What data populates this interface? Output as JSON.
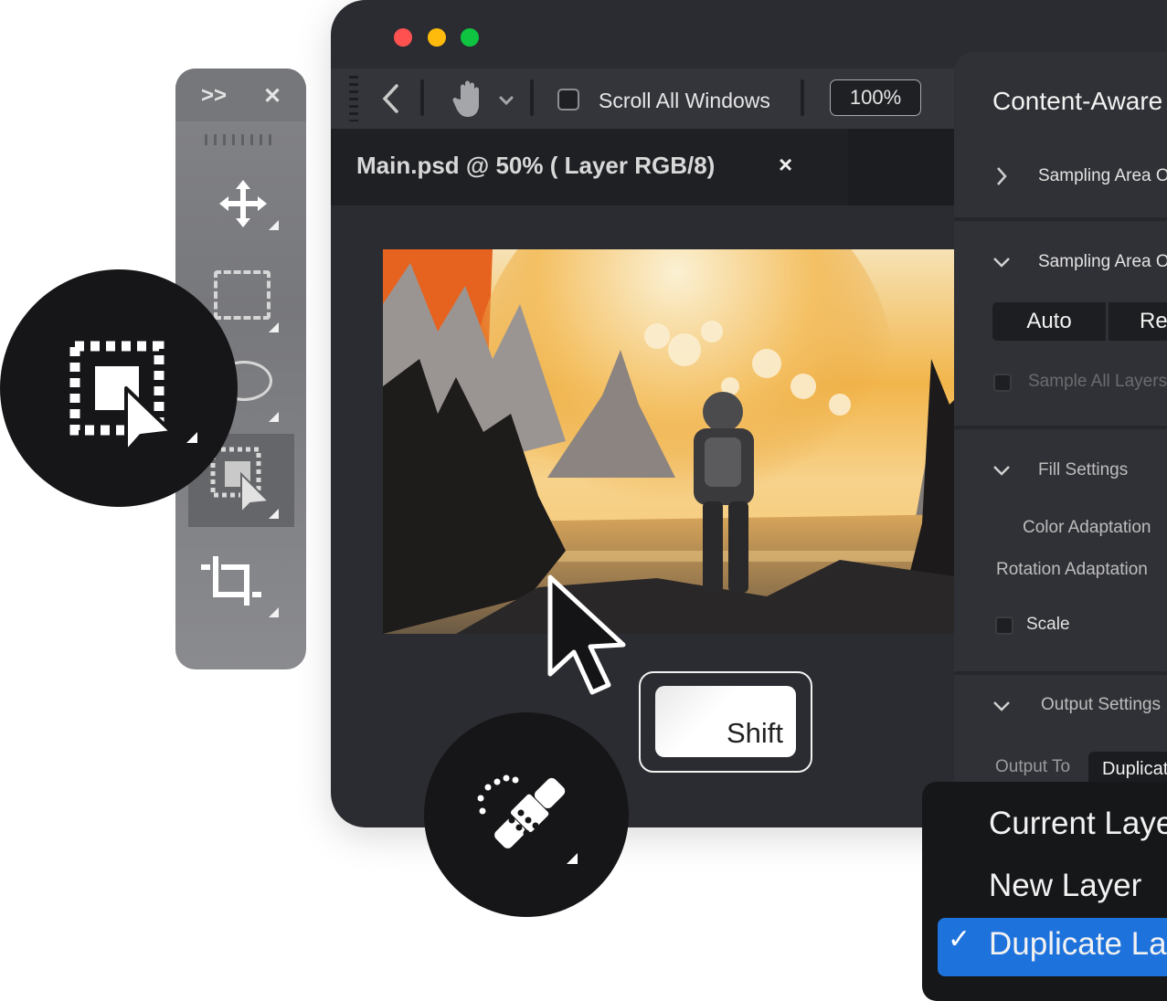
{
  "window": {
    "traffic_lights": [
      {
        "name": "close",
        "color": "#fe5150"
      },
      {
        "name": "minimize",
        "color": "#febb0c"
      },
      {
        "name": "maximize",
        "color": "#0ec440"
      }
    ],
    "toolbar": {
      "back_icon": "chevron-left-icon",
      "tool_icon": "hand-icon",
      "tool_dropdown_icon": "chevron-down-icon",
      "scroll_all_windows_label": "Scroll All Windows",
      "scroll_all_windows_checked": false,
      "zoom_value": "100%"
    },
    "tab": {
      "title": "Main.psd @ 50% ( Layer RGB/8)",
      "close_label": "×"
    },
    "canvas": {
      "image_description": "Astronaut standing by a lake looking at mountains under a large sunlit sky"
    }
  },
  "panel": {
    "title": "Content-Aware Fill",
    "sections": {
      "sampling_area_collapsed": "Sampling Area Options",
      "sampling_area_expanded": "Sampling Area Options",
      "sampling_modes": [
        "Auto",
        "Rectangular"
      ],
      "sample_all_layers": "Sample All Layers",
      "fill_settings": "Fill Settings",
      "color_adaptation": "Color Adaptation",
      "rotation_adaptation": "Rotation Adaptation",
      "scale_label": "Scale",
      "output_settings": "Output Settings",
      "output_to_label": "Output To",
      "output_to_value": "Duplicate Layer"
    }
  },
  "dropdown": {
    "options": [
      "Current Layer",
      "New Layer",
      "Duplicate Layer"
    ],
    "selected": "Duplicate Layer",
    "check_icon": "✓",
    "accent": "#1e72dc"
  },
  "tools_panel": {
    "expand_label": ">>",
    "close_label": "✕",
    "tools": [
      "move-tool",
      "rectangular-marquee-tool",
      "elliptical-marquee-tool",
      "object-selection-tool",
      "crop-tool"
    ],
    "active_tool": "object-selection-tool"
  },
  "overlays": {
    "shift_key_label": "Shift",
    "featured_tool_top": "object-selection-tool",
    "featured_tool_bottom": "healing-brush-tool"
  }
}
